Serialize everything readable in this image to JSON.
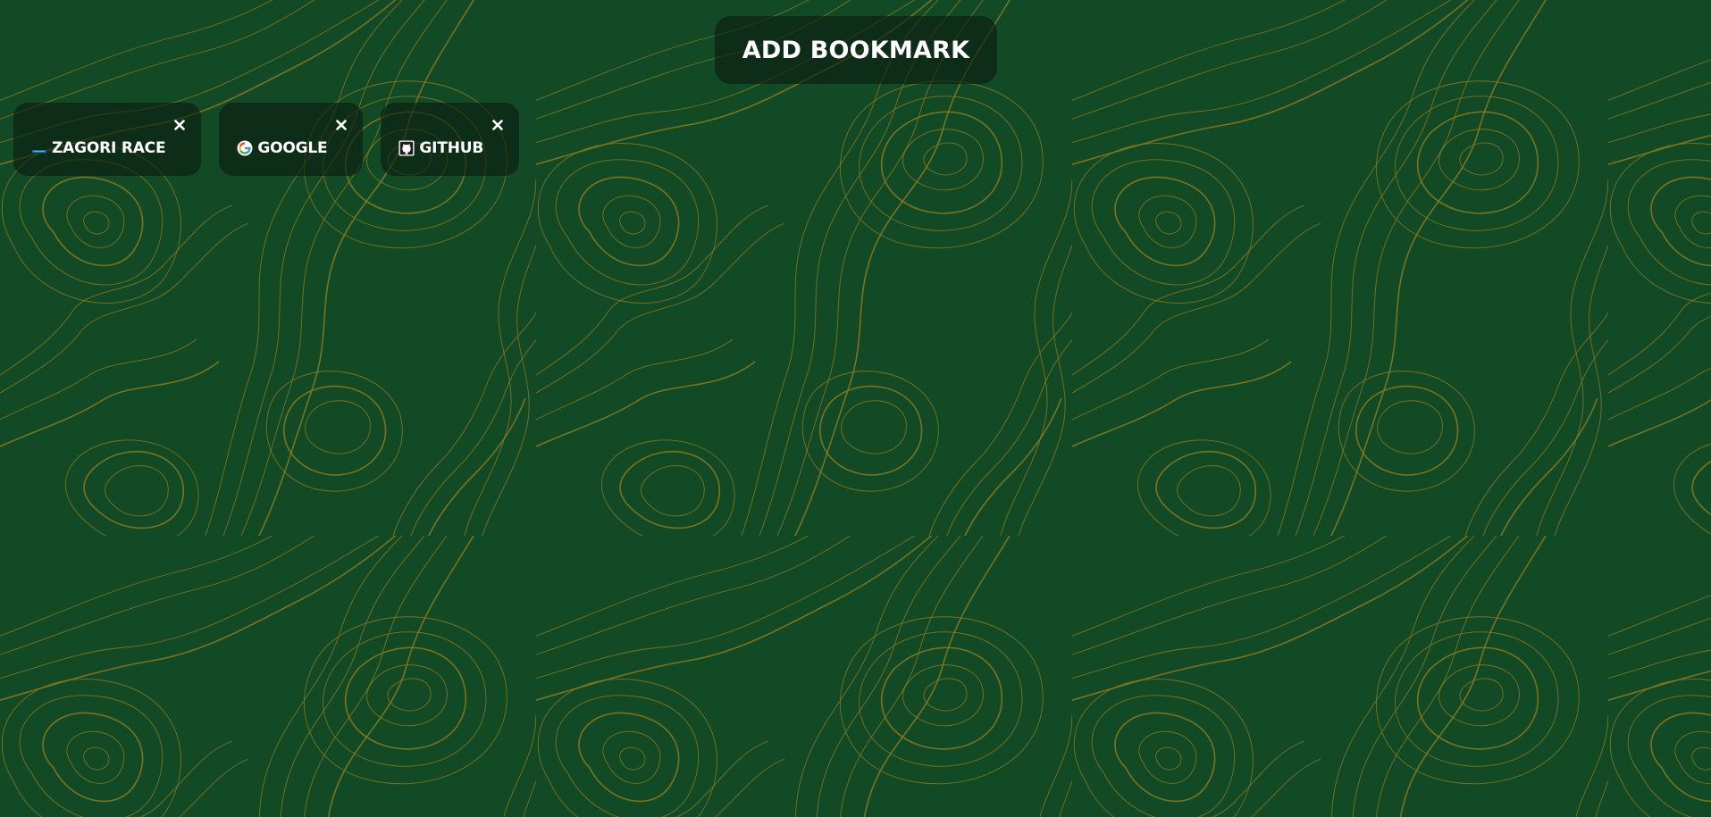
{
  "toolbar": {
    "add_bookmark_label": "ADD BOOKMARK"
  },
  "bookmarks": [
    {
      "label": "ZAGORI RACE",
      "icon": "zagori-race-favicon",
      "close_icon": "close-icon"
    },
    {
      "label": "GOOGLE",
      "icon": "google-favicon",
      "close_icon": "close-icon"
    },
    {
      "label": "GITHUB",
      "icon": "github-favicon",
      "close_icon": "close-icon"
    }
  ],
  "colors": {
    "background": "#134a26",
    "contour_lines": "#8a7a1c",
    "panel": "rgba(10, 28, 16, 0.62)",
    "text": "#ffffff"
  }
}
